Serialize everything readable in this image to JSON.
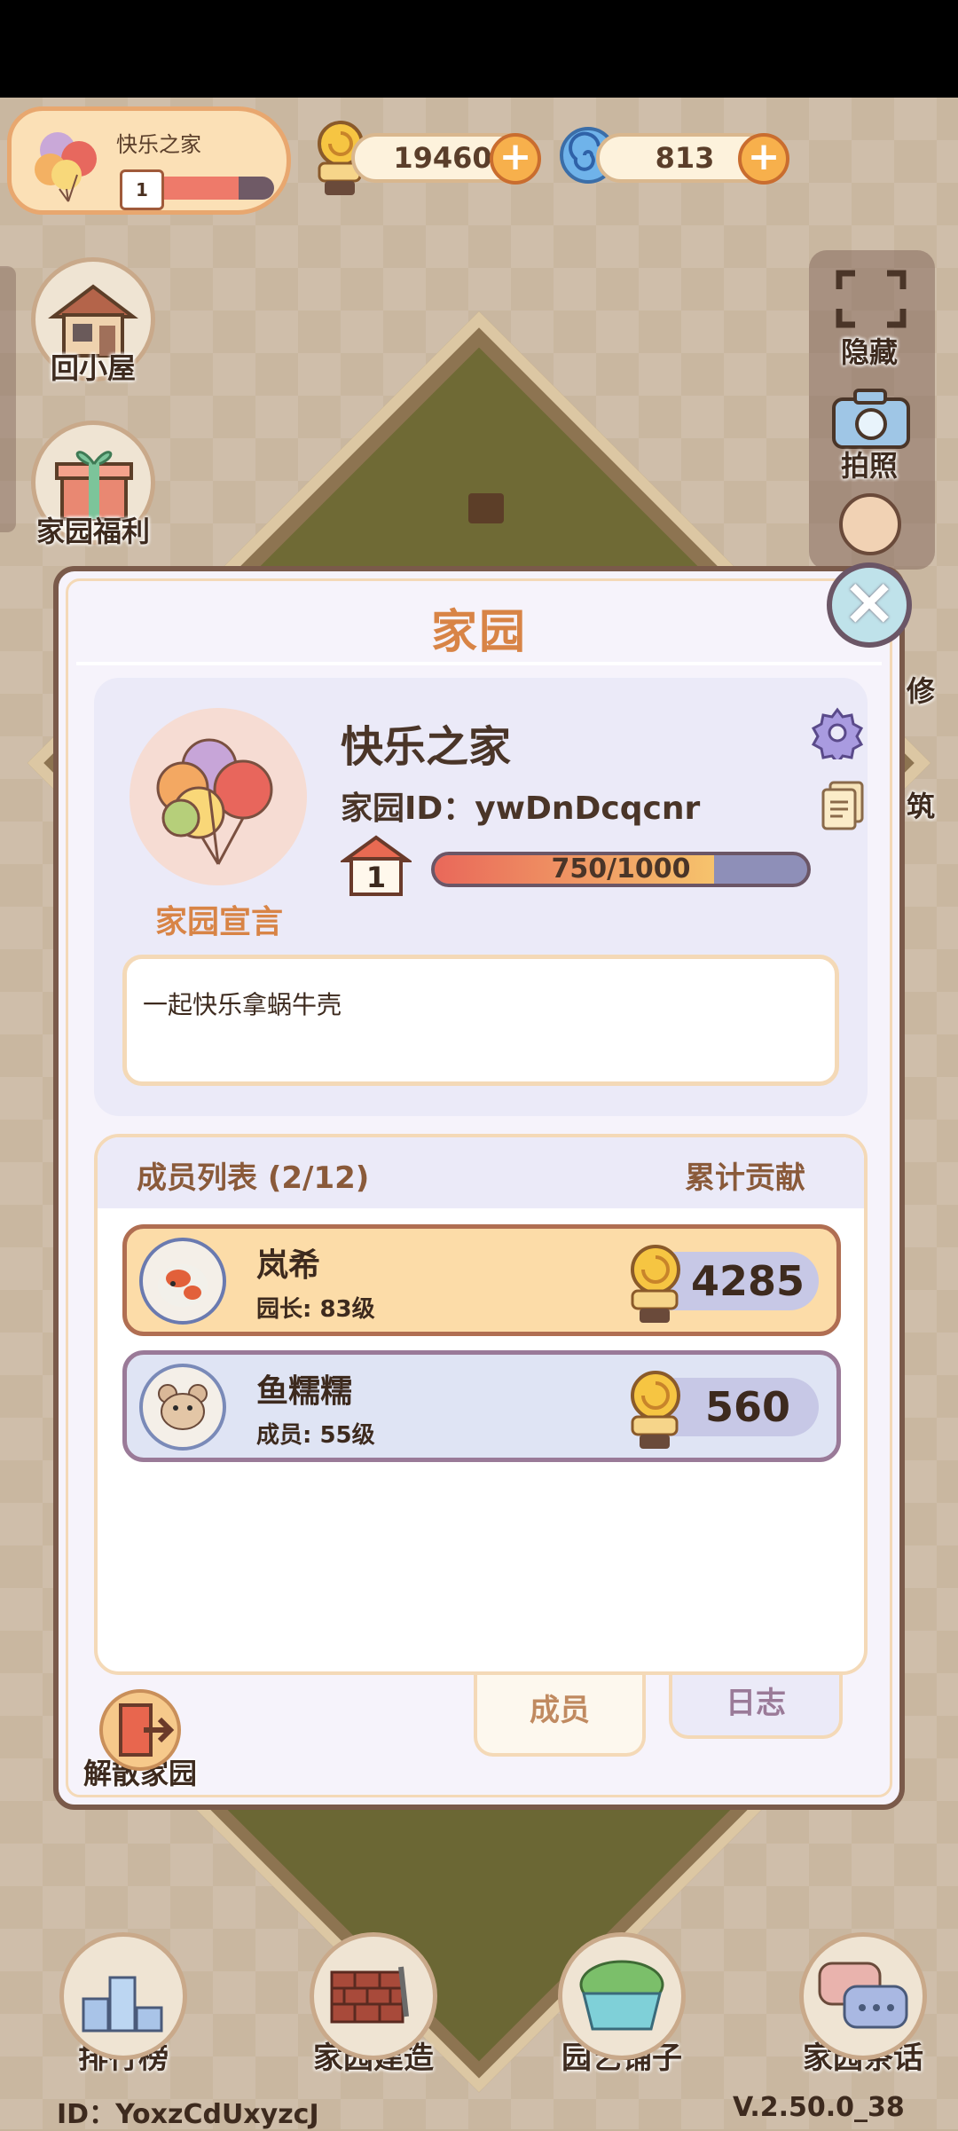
{
  "hud": {
    "home_name": "快乐之家",
    "home_level": "1",
    "home_exp_fraction": 0.75,
    "snail_shells": "19460",
    "swirl_currency": "813"
  },
  "side_left": {
    "back_home": "回小屋",
    "welfare": "家园福利"
  },
  "side_right": {
    "hide": "隐藏",
    "photo": "拍照",
    "decorate_partial": "修",
    "build_partial": "筑"
  },
  "modal": {
    "title": "家园",
    "home_name": "快乐之家",
    "home_id": "家园ID：ywDnDcqcnr",
    "level": "1",
    "exp_text": "750/1000",
    "exp_fraction": 0.75,
    "declaration_title": "家园宣言",
    "declaration_text": "一起快乐拿蜗牛壳",
    "members_title": "成员列表 (2/12)",
    "contribution_title": "累计贡献",
    "members": [
      {
        "name": "岚希",
        "role": "园长: 83级",
        "score": "4285"
      },
      {
        "name": "鱼糯糯",
        "role": "成员: 55级",
        "score": "560"
      }
    ],
    "tabs": {
      "members": "成员",
      "log": "日志"
    },
    "disband": "解散家园"
  },
  "bottom_nav": {
    "rank": "排行榜",
    "build": "家园建造",
    "shop": "园艺铺子",
    "chat": "家园茶话"
  },
  "footer": {
    "user_id": "ID：YoxzCdUxyzcJ",
    "version": "V.2.50.0_38"
  },
  "colors": {
    "title_orange": "#d88446",
    "leader_row": "#fcdca8",
    "member_row": "#dfe4f4"
  }
}
